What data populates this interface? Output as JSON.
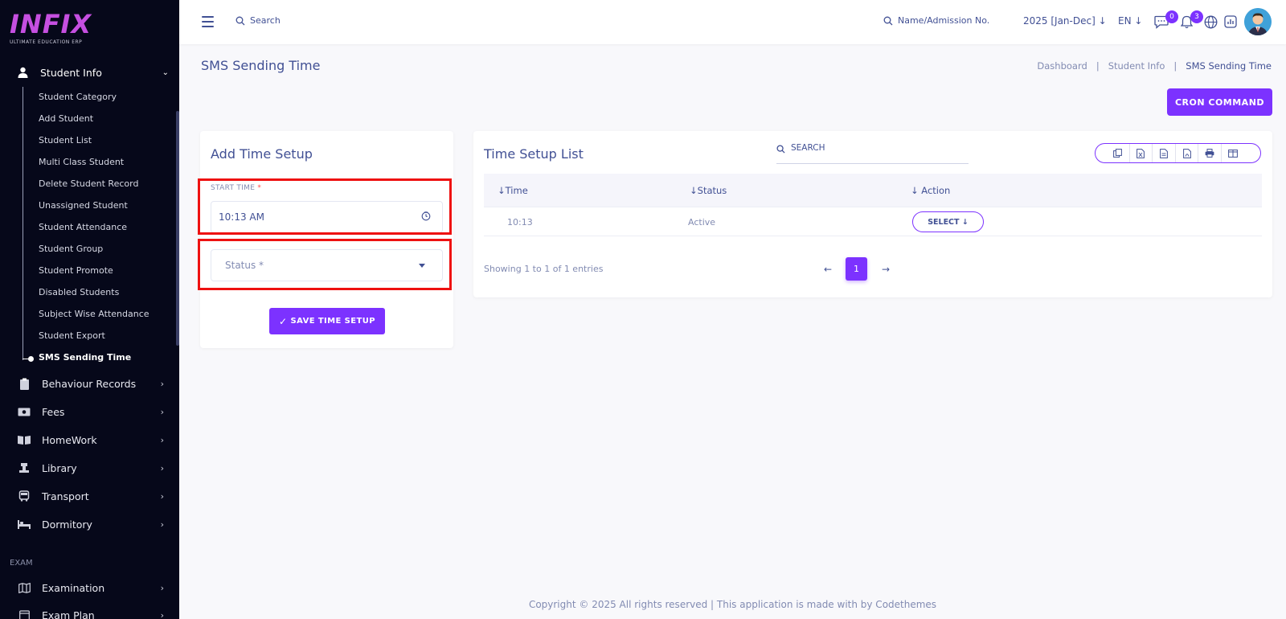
{
  "brand": {
    "logo": "INFIX",
    "tagline": "ULTIMATE EDUCATION ERP"
  },
  "sidebar": {
    "section_head": "Student Info",
    "sub_items": [
      "Student Category",
      "Add Student",
      "Student List",
      "Multi Class Student",
      "Delete Student Record",
      "Unassigned Student",
      "Student Attendance",
      "Student Group",
      "Student Promote",
      "Disabled Students",
      "Subject Wise Attendance",
      "Student Export",
      "SMS Sending Time"
    ],
    "active_sub": "SMS Sending Time",
    "items": [
      "Behaviour Records",
      "Fees",
      "HomeWork",
      "Library",
      "Transport",
      "Dormitory"
    ],
    "exam_section": "EXAM",
    "exam_items": [
      "Examination",
      "Exam Plan"
    ]
  },
  "topbar": {
    "search_placeholder": "Search",
    "name_search": "Name/Admission No.",
    "session": "2025 [Jan-Dec]",
    "language": "EN",
    "messages_badge": "0",
    "notifications_badge": "3"
  },
  "page": {
    "title": "SMS Sending Time",
    "breadcrumb": [
      "Dashboard",
      "Student Info",
      "SMS Sending Time"
    ],
    "cron_button": "CRON COMMAND"
  },
  "form": {
    "title": "Add Time Setup",
    "start_time_label": "START TIME",
    "required_mark": "*",
    "start_time_value": "10:13 AM",
    "status_placeholder": "Status *",
    "save_button": "SAVE TIME SETUP",
    "save_icon": "checkmark-icon"
  },
  "list": {
    "title": "Time Setup List",
    "search_placeholder": "SEARCH",
    "export_icons": [
      "copy-icon",
      "excel-icon",
      "csv-icon",
      "pdf-icon",
      "print-icon",
      "columns-icon"
    ],
    "columns": [
      "Time",
      "Status",
      "Action"
    ],
    "rows": [
      {
        "time": "10:13",
        "status": "Active",
        "action": "SELECT"
      }
    ],
    "showing": "Showing 1 to 1 of 1 entries",
    "current_page": "1"
  },
  "footer": "Copyright © 2025 All rights reserved | This application is made with by Codethemes",
  "colors": {
    "accent": "#7c32ff",
    "sidebar_bg": "#06081a",
    "text": "#415094",
    "highlight": "#ee1111"
  }
}
